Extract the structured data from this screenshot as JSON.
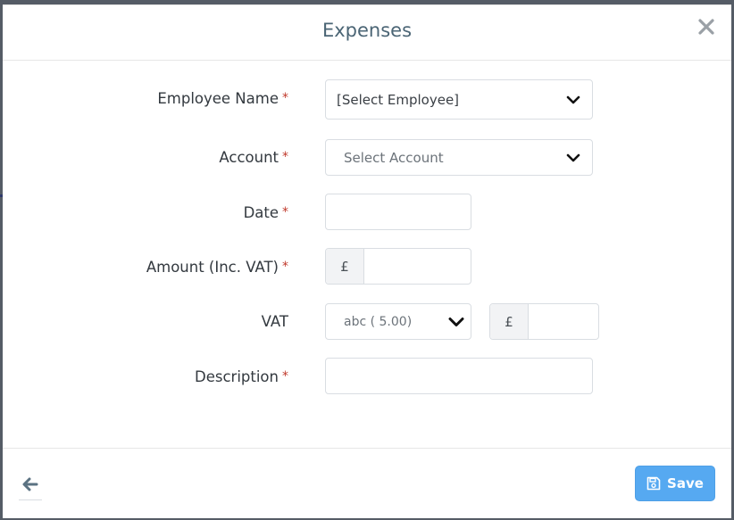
{
  "modal": {
    "title": "Expenses",
    "close_icon": "close-icon"
  },
  "form": {
    "required_marker": "*",
    "employee": {
      "label": "Employee Name",
      "value": "[Select Employee]"
    },
    "account": {
      "label": "Account",
      "placeholder": "Select Account"
    },
    "date": {
      "label": "Date",
      "value": ""
    },
    "amount": {
      "label": "Amount (Inc. VAT)",
      "currency": "£",
      "value": ""
    },
    "vat": {
      "label": "VAT",
      "selected": "abc ( 5.00)",
      "currency": "£",
      "value": ""
    },
    "description": {
      "label": "Description",
      "value": ""
    }
  },
  "footer": {
    "back_icon": "arrow-left-icon",
    "save_label": "Save",
    "save_icon": "floppy-disk-icon"
  },
  "colors": {
    "title": "#4b6575",
    "required": "#c0392b",
    "save_button": "#56a9f1"
  }
}
